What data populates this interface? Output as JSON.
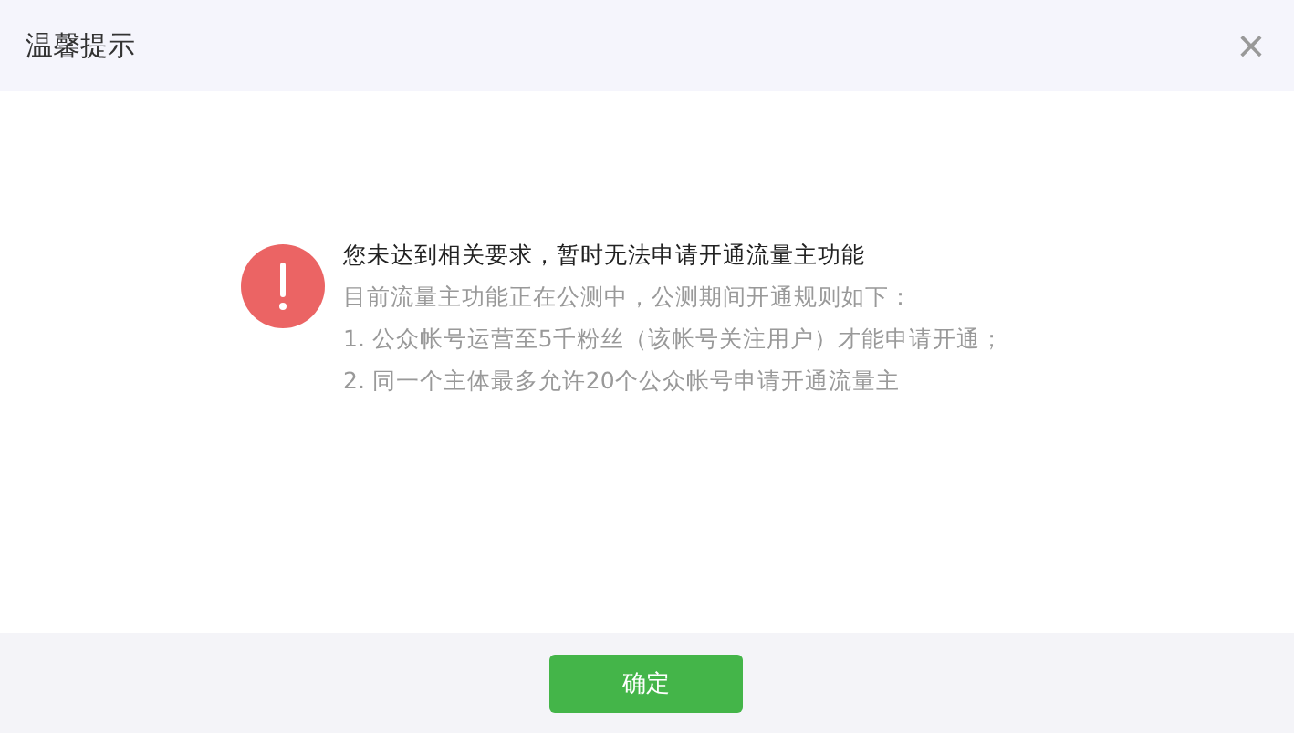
{
  "dialog": {
    "title": "温馨提示",
    "close_icon": "×"
  },
  "message": {
    "headline": "您未达到相关要求，暂时无法申请开通流量主功能",
    "lines": [
      "目前流量主功能正在公测中，公测期间开通规则如下：",
      "1. 公众帐号运营至5千粉丝（该帐号关注用户）才能申请开通；",
      "2. 同一个主体最多允许20个公众帐号申请开通流量主"
    ]
  },
  "buttons": [
    "确定"
  ]
}
